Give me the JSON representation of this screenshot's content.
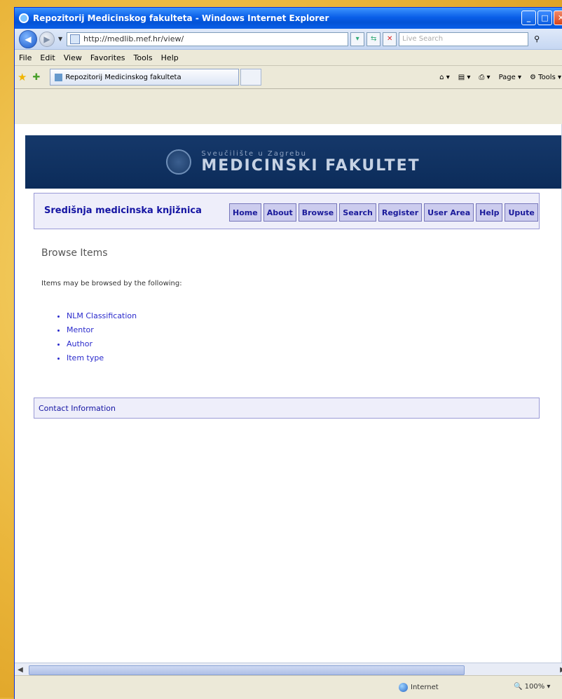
{
  "window": {
    "title": "Repozitorij Medicinskog fakulteta - Windows Internet Explorer"
  },
  "address_bar": {
    "url": "http://medlib.mef.hr/view/",
    "search_placeholder": "Live Search"
  },
  "menu": [
    "File",
    "Edit",
    "View",
    "Favorites",
    "Tools",
    "Help"
  ],
  "tab": {
    "label": "Repozitorij Medicinskog fakulteta"
  },
  "command_bar": {
    "page_label": "Page",
    "tools_label": "Tools"
  },
  "banner": {
    "subtitle": "Sveučilište u Zagrebu",
    "title": "MEDICINSKI FAKULTET"
  },
  "site": {
    "name": "Središnja medicinska knjižnica",
    "nav": [
      "Home",
      "About",
      "Browse",
      "Search",
      "Register",
      "User Area",
      "Help",
      "Upute"
    ]
  },
  "content": {
    "heading": "Browse Items",
    "intro": "Items may be browsed by the following:",
    "options": [
      "NLM Classification",
      "Mentor",
      "Author",
      "Item type"
    ]
  },
  "footer": {
    "contact": "Contact Information"
  },
  "status": {
    "zone": "Internet",
    "zoom": "100%"
  }
}
